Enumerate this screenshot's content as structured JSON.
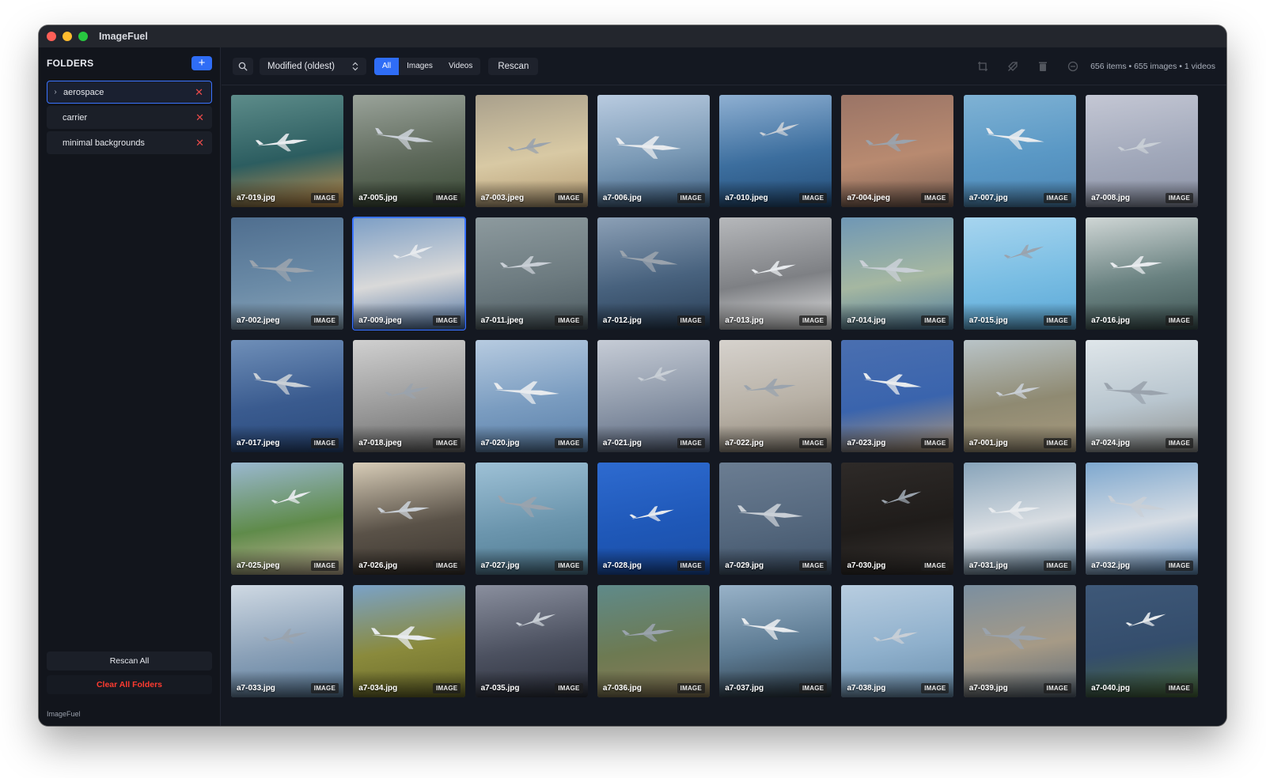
{
  "window": {
    "title": "ImageFuel"
  },
  "sidebar": {
    "title": "FOLDERS",
    "add_label": "+",
    "folders": [
      {
        "name": "aerospace",
        "active": true
      },
      {
        "name": "carrier",
        "active": false
      },
      {
        "name": "minimal backgrounds",
        "active": false
      }
    ],
    "remove_glyph": "✕",
    "rescan_all_label": "Rescan All",
    "clear_all_label": "Clear All Folders",
    "footer": "ImageFuel"
  },
  "toolbar": {
    "search_icon": "search-icon",
    "sort_value": "Modified (oldest)",
    "filters": [
      {
        "label": "All",
        "active": true
      },
      {
        "label": "Images",
        "active": false
      },
      {
        "label": "Videos",
        "active": false
      }
    ],
    "rescan_label": "Rescan",
    "right_icons": [
      "crop-icon",
      "tag-off-icon",
      "trash-icon",
      "info-icon"
    ],
    "status": "656 items • 655 images • 1 videos"
  },
  "colors": {
    "accent": "#2f6df6",
    "danger": "#ff3b30",
    "background": "#141821"
  },
  "gallery": {
    "items": [
      {
        "name": "a7-019.jpg",
        "type": "IMAGE",
        "bg": [
          "#5d8c8a",
          "#2c5d60",
          "#c9904a"
        ]
      },
      {
        "name": "a7-005.jpg",
        "type": "IMAGE",
        "bg": [
          "#9aa39a",
          "#5f6a5c",
          "#3a4a35"
        ]
      },
      {
        "name": "a7-003.jpeg",
        "type": "IMAGE",
        "bg": [
          "#a9a08c",
          "#d8c9a4",
          "#b59b72"
        ]
      },
      {
        "name": "a7-006.jpg",
        "type": "IMAGE",
        "bg": [
          "#b9cbe0",
          "#7a99b5",
          "#3d5f82"
        ]
      },
      {
        "name": "a7-010.jpeg",
        "type": "IMAGE",
        "bg": [
          "#8fb0d2",
          "#3c6e9e",
          "#244d78"
        ]
      },
      {
        "name": "a7-004.jpeg",
        "type": "IMAGE",
        "bg": [
          "#9a7466",
          "#b88a70",
          "#7a5f52"
        ]
      },
      {
        "name": "a7-007.jpg",
        "type": "IMAGE",
        "bg": [
          "#7fb2d4",
          "#5a98c5",
          "#4c86b5"
        ]
      },
      {
        "name": "a7-008.jpg",
        "type": "IMAGE",
        "bg": [
          "#c4c7d4",
          "#a1a8ba",
          "#8d93a6"
        ]
      },
      {
        "name": "a7-002.jpeg",
        "type": "IMAGE",
        "bg": [
          "#4f6e8f",
          "#6a8aa6",
          "#8aa4b8"
        ]
      },
      {
        "name": "a7-009.jpeg",
        "type": "IMAGE",
        "bg": [
          "#7c9ec5",
          "#d9d9d9",
          "#4f73a2"
        ]
      },
      {
        "name": "a7-011.jpeg",
        "type": "IMAGE",
        "bg": [
          "#8d9a9e",
          "#6d7b80",
          "#4d5b61"
        ]
      },
      {
        "name": "a7-012.jpg",
        "type": "IMAGE",
        "bg": [
          "#8ca0b6",
          "#48627e",
          "#2a3f57"
        ]
      },
      {
        "name": "a7-013.jpg",
        "type": "IMAGE",
        "bg": [
          "#b6b8bb",
          "#7e8084",
          "#e6e6e6"
        ]
      },
      {
        "name": "a7-014.jpg",
        "type": "IMAGE",
        "bg": [
          "#6f97b5",
          "#a5b7a1",
          "#4f7c9d"
        ]
      },
      {
        "name": "a7-015.jpg",
        "type": "IMAGE",
        "bg": [
          "#a7d5ef",
          "#79bde3",
          "#5aa7d6"
        ]
      },
      {
        "name": "a7-016.jpg",
        "type": "IMAGE",
        "bg": [
          "#cfd6d5",
          "#6a8281",
          "#3e5453"
        ]
      },
      {
        "name": "a7-017.jpeg",
        "type": "IMAGE",
        "bg": [
          "#6f8fb8",
          "#3a5b8f",
          "#2a4a7c"
        ]
      },
      {
        "name": "a7-018.jpeg",
        "type": "IMAGE",
        "bg": [
          "#d0d0d0",
          "#9a9a9a",
          "#6c6c6c"
        ]
      },
      {
        "name": "a7-020.jpg",
        "type": "IMAGE",
        "bg": [
          "#b7cbe0",
          "#7a9cc0",
          "#5a7fa8"
        ]
      },
      {
        "name": "a7-021.jpg",
        "type": "IMAGE",
        "bg": [
          "#c6ccd6",
          "#8c97a8",
          "#5b6880"
        ]
      },
      {
        "name": "a7-022.jpg",
        "type": "IMAGE",
        "bg": [
          "#d6d2cd",
          "#b8b1a6",
          "#8f8679"
        ]
      },
      {
        "name": "a7-023.jpg",
        "type": "IMAGE",
        "bg": [
          "#4a6fb0",
          "#3a64ad",
          "#b49a7a"
        ]
      },
      {
        "name": "a7-001.jpg",
        "type": "IMAGE",
        "bg": [
          "#b9c4c8",
          "#8f8a72",
          "#a89a7e"
        ]
      },
      {
        "name": "a7-024.jpg",
        "type": "IMAGE",
        "bg": [
          "#dfe6ea",
          "#b9c6cf",
          "#8e8f8c"
        ]
      },
      {
        "name": "a7-025.jpeg",
        "type": "IMAGE",
        "bg": [
          "#9ab8d0",
          "#5f8b4a",
          "#c9b79a"
        ]
      },
      {
        "name": "a7-026.jpg",
        "type": "IMAGE",
        "bg": [
          "#d8cdb8",
          "#5a5248",
          "#3a342e"
        ]
      },
      {
        "name": "a7-027.jpg",
        "type": "IMAGE",
        "bg": [
          "#9ec1d6",
          "#6b95ad",
          "#4f7a91"
        ]
      },
      {
        "name": "a7-028.jpg",
        "type": "IMAGE",
        "bg": [
          "#2e6bd0",
          "#1f58b8",
          "#1a4ea6"
        ]
      },
      {
        "name": "a7-029.jpg",
        "type": "IMAGE",
        "bg": [
          "#6b7d92",
          "#55687e",
          "#3f5268"
        ]
      },
      {
        "name": "a7-030.jpg",
        "type": "IMAGE",
        "bg": [
          "#2e2a28",
          "#1f1c1a",
          "#3a3532"
        ]
      },
      {
        "name": "a7-031.jpg",
        "type": "IMAGE",
        "bg": [
          "#88a4ba",
          "#d8dde2",
          "#5a7890"
        ]
      },
      {
        "name": "a7-032.jpg",
        "type": "IMAGE",
        "bg": [
          "#7ea8cf",
          "#d7dde4",
          "#5f8bb8"
        ]
      },
      {
        "name": "a7-033.jpg",
        "type": "IMAGE",
        "bg": [
          "#cfd9e3",
          "#8ba1b8",
          "#5b7c9b"
        ]
      },
      {
        "name": "a7-034.jpg",
        "type": "IMAGE",
        "bg": [
          "#7aa2c8",
          "#8a8a3c",
          "#6a6a2a"
        ]
      },
      {
        "name": "a7-035.jpg",
        "type": "IMAGE",
        "bg": [
          "#8a8f9e",
          "#4c5160",
          "#2c303c"
        ]
      },
      {
        "name": "a7-036.jpg",
        "type": "IMAGE",
        "bg": [
          "#5f8a8a",
          "#6d7a52",
          "#8b7a58"
        ]
      },
      {
        "name": "a7-037.jpg",
        "type": "IMAGE",
        "bg": [
          "#98b2c8",
          "#5c7a92",
          "#2a3640"
        ]
      },
      {
        "name": "a7-038.jpg",
        "type": "IMAGE",
        "bg": [
          "#b8cde0",
          "#8fb0cc",
          "#6a8eac"
        ]
      },
      {
        "name": "a7-039.jpg",
        "type": "IMAGE",
        "bg": [
          "#7b8fa0",
          "#a69a86",
          "#5a6876"
        ]
      },
      {
        "name": "a7-040.jpg",
        "type": "IMAGE",
        "bg": [
          "#3e5878",
          "#344d6c",
          "#4a6a3c"
        ]
      }
    ],
    "next_row_colors": [
      "#2a3550",
      "#6a8fb8",
      "#8aa0aa",
      "#6b7a8a",
      "#3c4c64",
      "#5a7ab0",
      "#8db8d8",
      "#d6dde4"
    ]
  }
}
